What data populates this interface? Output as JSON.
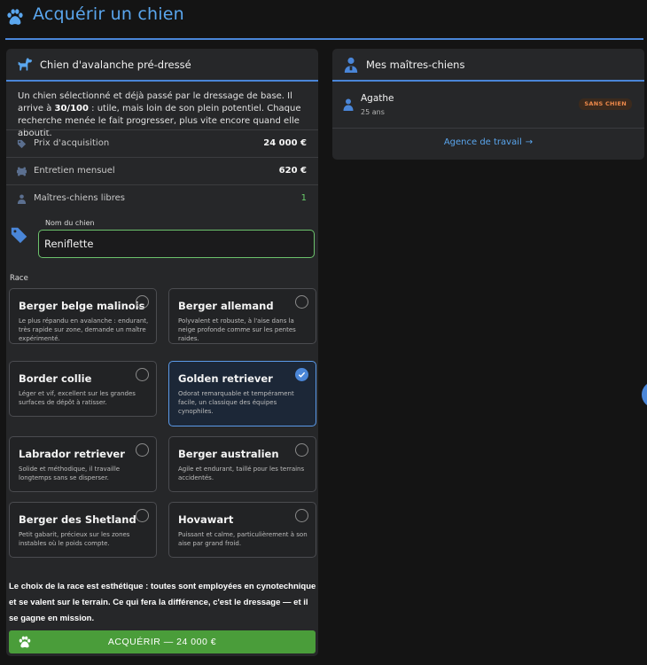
{
  "header": {
    "title": "Acquérir un chien",
    "icon": "paw-icon"
  },
  "purchase_panel": {
    "title": "Chien d'avalanche pré-dressé",
    "icon": "dog-icon",
    "intro_before": "Un chien sélectionné et déjà passé par le dressage de base. Il arrive à ",
    "intro_bold": "30/100",
    "intro_after": " : utile, mais loin de son plein potentiel. Chaque recherche menée le fait progresser, plus vite encore quand elle aboutit.",
    "stats": [
      {
        "label": "Prix d'acquisition",
        "value": "24 000 €",
        "icon": "tag-icon"
      },
      {
        "label": "Entretien mensuel",
        "value": "620 €",
        "icon": "bone-icon"
      },
      {
        "label": "Maîtres-chiens libres",
        "value": "1",
        "icon": "person-icon"
      }
    ],
    "name_field": {
      "label": "Nom du chien",
      "value": "Reniflette"
    },
    "race_label": "Race",
    "breeds": [
      {
        "name": "Berger belge malinois",
        "desc": "Le plus répandu en avalanche : endurant, très rapide sur zone, demande un maître expérimenté.",
        "selected": false
      },
      {
        "name": "Berger allemand",
        "desc": "Polyvalent et robuste, à l'aise dans la neige profonde comme sur les pentes raides.",
        "selected": false
      },
      {
        "name": "Border collie",
        "desc": "Léger et vif, excellent sur les grandes surfaces de dépôt à ratisser.",
        "selected": false
      },
      {
        "name": "Golden retriever",
        "desc": "Odorat remarquable et tempérament facile, un classique des équipes cynophiles.",
        "selected": true
      },
      {
        "name": "Labrador retriever",
        "desc": "Solide et méthodique, il travaille longtemps sans se disperser.",
        "selected": false
      },
      {
        "name": "Berger australien",
        "desc": "Agile et endurant, taillé pour les terrains accidentés.",
        "selected": false
      },
      {
        "name": "Berger des Shetland",
        "desc": "Petit gabarit, précieux sur les zones instables où le poids compte.",
        "selected": false
      },
      {
        "name": "Hovawart",
        "desc": "Puissant et calme, particulièrement à son aise par grand froid.",
        "selected": false
      }
    ],
    "race_note": "Le choix de la race est esthétique : toutes sont employées en cynotechnique et se valent sur le terrain. Ce qui fera la différence, c'est le dressage — et il se gagne en mission.",
    "buy_button": "ACQUÉRIR — 24 000 €"
  },
  "handlers_panel": {
    "title": "Mes maîtres-chiens",
    "icon": "handler-icon",
    "handlers": [
      {
        "name": "Agathe",
        "age": "25 ans",
        "badge": "SANS CHIEN"
      }
    ],
    "agency_link": "Agence de travail",
    "agency_arrow": "→"
  },
  "colors": {
    "accent": "#4a86d8",
    "link": "#5aa6ee",
    "success": "#4a9d3a",
    "badge": "#f08a4b"
  }
}
